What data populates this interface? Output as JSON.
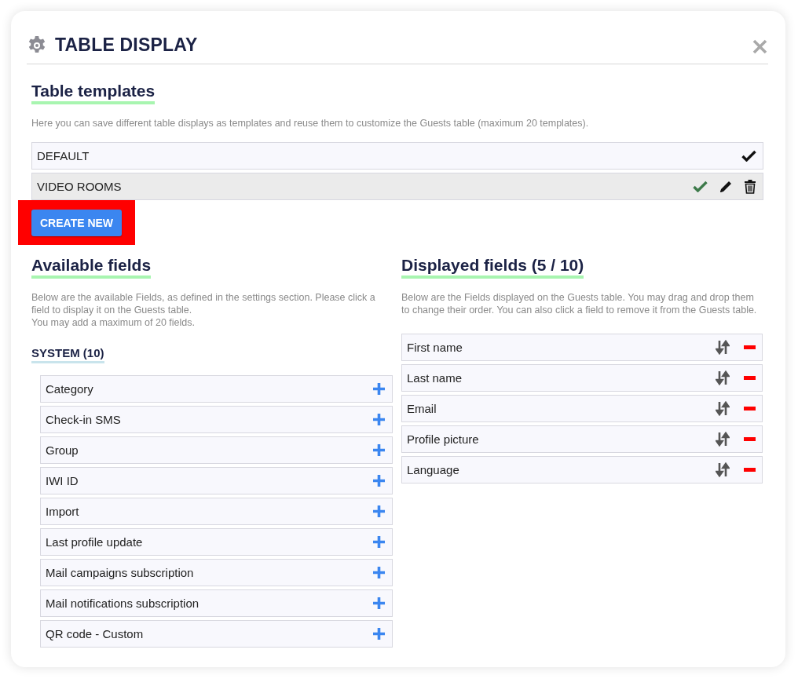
{
  "dialog": {
    "title": "TABLE DISPLAY"
  },
  "templates": {
    "heading": "Table templates",
    "description": "Here you can save different table displays as templates and reuse them to customize the Guests table (maximum 20 templates).",
    "items": [
      {
        "name": "DEFAULT",
        "selected": true
      },
      {
        "name": "VIDEO ROOMS",
        "selected": false
      }
    ],
    "create_button": "CREATE NEW",
    "create_button_highlighted": true
  },
  "available": {
    "heading": "Available fields",
    "description": "Below are the available Fields, as defined in the settings section. Please click a field to display it on the Guests table.\nYou may add a maximum of 20 fields.",
    "group": "SYSTEM (10)",
    "items": [
      "Category",
      "Check-in SMS",
      "Group",
      "IWI ID",
      "Import",
      "Last profile update",
      "Mail campaigns subscription",
      "Mail notifications subscription",
      "QR code - Custom"
    ]
  },
  "displayed": {
    "heading": "Displayed fields (5 / 10)",
    "description": "Below are the Fields displayed on the Guests table. You may drag and drop them to change their order. You can also click a field to remove it from the Guests table.",
    "items": [
      "First name",
      "Last name",
      "Email",
      "Profile picture",
      "Language"
    ]
  }
}
